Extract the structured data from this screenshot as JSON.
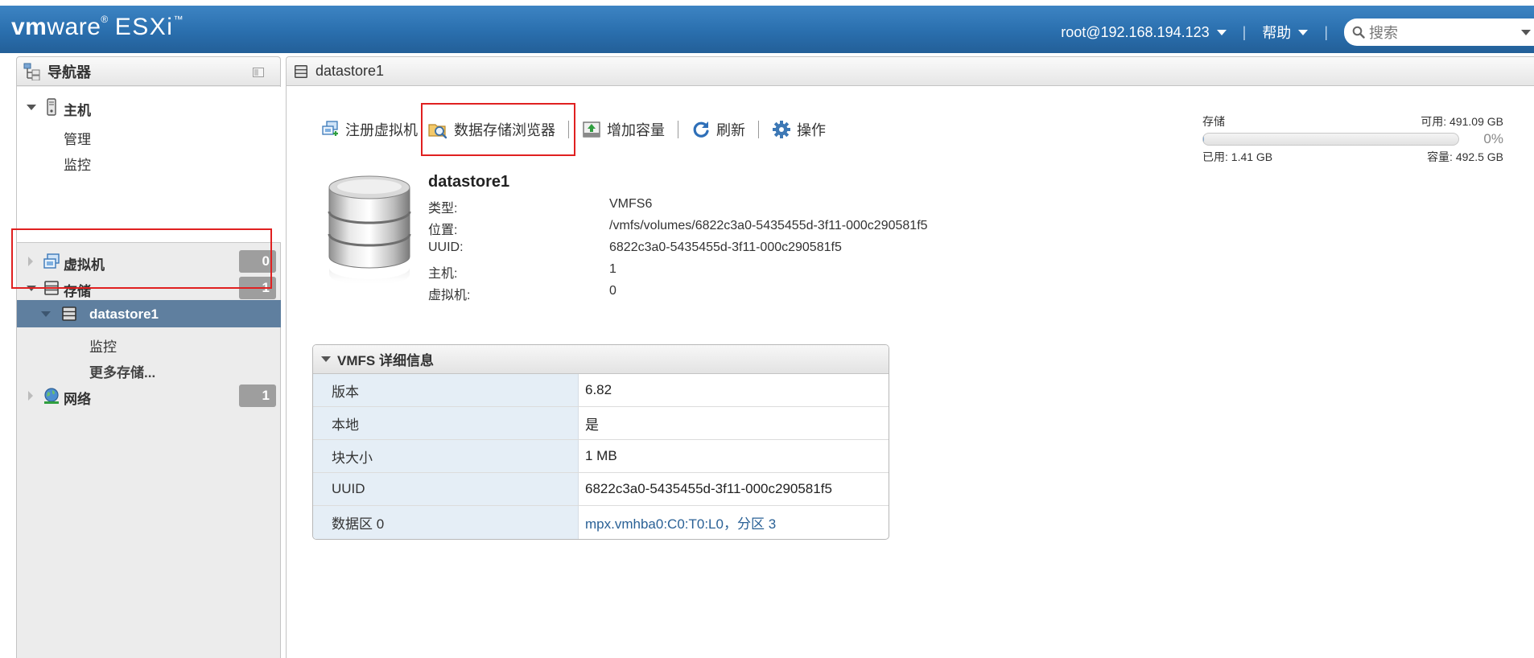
{
  "brand": {
    "vm": "vm",
    "ware": "ware",
    "reg": "®",
    "product": "ESXi",
    "tm": "™"
  },
  "header": {
    "user": "root@192.168.194.123",
    "help": "帮助",
    "separator": "|",
    "search_placeholder": "搜索"
  },
  "navigator": {
    "title": "导航器",
    "host": {
      "label": "主机",
      "children": [
        "管理",
        "监控"
      ]
    },
    "vms": {
      "label": "虚拟机",
      "count": "0"
    },
    "storage": {
      "label": "存储",
      "count": "1"
    },
    "datastore": {
      "label": "datastore1",
      "children": [
        "监控",
        "更多存储..."
      ]
    },
    "network": {
      "label": "网络",
      "count": "1"
    }
  },
  "main": {
    "title": "datastore1",
    "toolbar": {
      "register_vm": "注册虚拟机",
      "datastore_browser": "数据存储浏览器",
      "increase_capacity": "增加容量",
      "refresh": "刷新",
      "actions": "操作"
    },
    "storage_summary": {
      "label": "存储",
      "free": "可用: 491.09 GB",
      "percent": "0%",
      "used": "已用: 1.41 GB",
      "capacity": "容量: 492.5 GB",
      "used_fraction": 0.003
    },
    "datastore": {
      "name": "datastore1",
      "props": [
        {
          "key": "类型:",
          "value": "VMFS6"
        },
        {
          "key": "位置:",
          "value": "/vmfs/volumes/6822c3a0-5435455d-3f11-000c290581f5"
        },
        {
          "key": "UUID:",
          "value": "6822c3a0-5435455d-3f11-000c290581f5"
        },
        {
          "key": "主机:",
          "value": "1"
        },
        {
          "key": "虚拟机:",
          "value": "0"
        }
      ]
    },
    "vmfs_details": {
      "title": "VMFS 详细信息",
      "rows": [
        {
          "key": "版本",
          "value": "6.82"
        },
        {
          "key": "本地",
          "value": "是"
        },
        {
          "key": "块大小",
          "value": "1 MB"
        },
        {
          "key": "UUID",
          "value": "6822c3a0-5435455d-3f11-000c290581f5"
        },
        {
          "key": "数据区 0",
          "value": "mpx.vmhba0:C0:T0:L0，分区 3"
        }
      ]
    }
  },
  "colors": {
    "header_blue": "#2a6fae",
    "selected_row": "#5f7f9f",
    "highlight_red": "#e02020",
    "link": "#2a6196"
  }
}
